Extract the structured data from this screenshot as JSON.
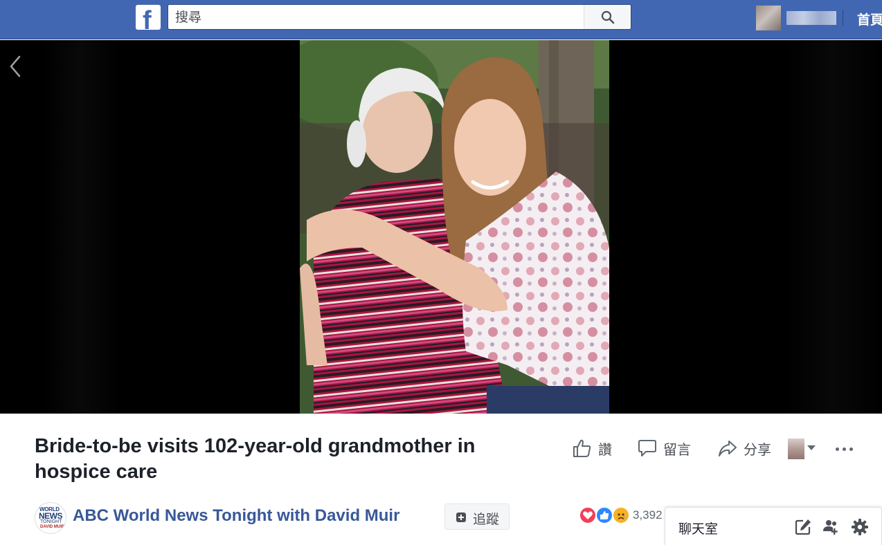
{
  "topbar": {
    "logo": "facebook-logo",
    "search_placeholder": "搜尋",
    "search_icon": "search-icon",
    "home_link": "首頁"
  },
  "viewer": {
    "prev_icon": "chevron-left-icon"
  },
  "post": {
    "title": "Bride-to-be visits 102-year-old grandmother in hospice care",
    "actions": {
      "like_label": "讚",
      "comment_label": "留言",
      "share_label": "分享"
    },
    "page": {
      "logo_lines": [
        "WORLD",
        "NEWS",
        "TONIGHT",
        "DAVID MUIR"
      ],
      "name": "ABC World News Tonight with David Muir",
      "follow_label": "追蹤"
    },
    "reactions": {
      "types": [
        "love",
        "like",
        "sad"
      ],
      "count": "3,392"
    }
  },
  "chat": {
    "title": "聊天室"
  },
  "colors": {
    "brand_blue": "#4267b2",
    "link_blue": "#385898",
    "text_dark": "#1d2129",
    "text_gray": "#4b4f56"
  }
}
